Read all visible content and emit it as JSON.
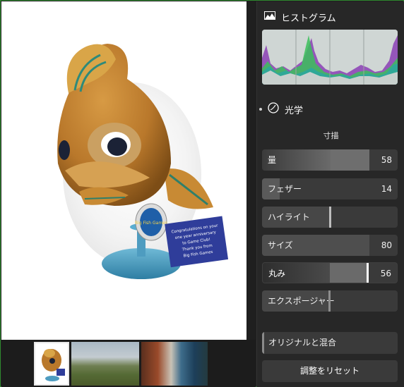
{
  "histogram": {
    "title": "ヒストグラム",
    "icon": "histogram-icon"
  },
  "optics": {
    "title": "光学",
    "icon": "optics-icon"
  },
  "vignette": {
    "subhead": "寸描",
    "sliders": [
      {
        "label": "量",
        "value": "58",
        "level": 0.58
      },
      {
        "label": "フェザー",
        "value": "14",
        "level": 0.14
      },
      {
        "label": "ハイライト",
        "value": "",
        "level": 0.5
      },
      {
        "label": "サイズ",
        "value": "80",
        "level": 0.8
      },
      {
        "label": "丸み",
        "value": "56",
        "level": 0.56
      },
      {
        "label": "エクスポージャー",
        "value": "",
        "level": 0.5
      }
    ]
  },
  "blend": {
    "label": "オリジナルと混合"
  },
  "reset": {
    "label": "調整をリセット"
  },
  "photo": {
    "card_lines": [
      "Congratulations on your",
      "one year anniversary",
      "to Game Club!",
      "Thank you from",
      "Big Fish Games"
    ],
    "badge_text": "Big Fish Games"
  },
  "colors": {
    "frame": "#2f8a2f",
    "panel": "#272727",
    "slider": "#3a3a3a"
  }
}
